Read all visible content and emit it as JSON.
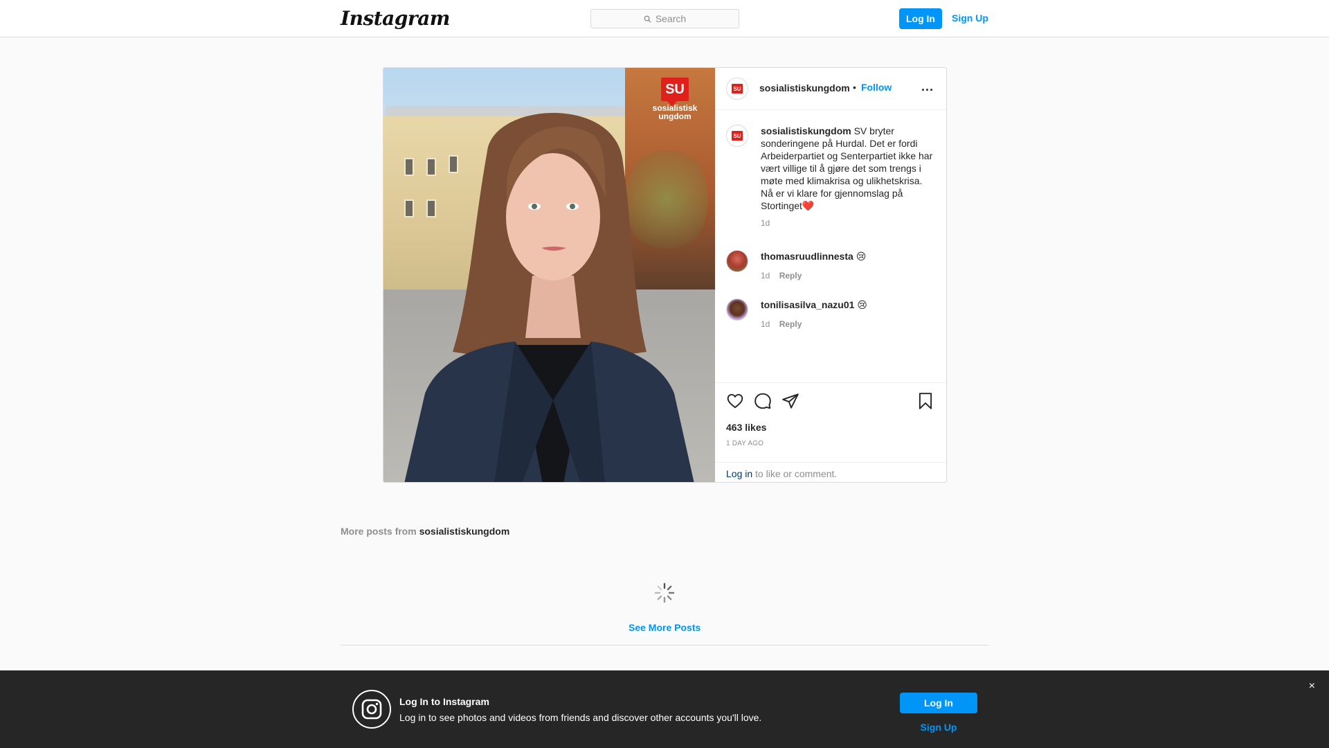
{
  "header": {
    "logo_text": "Instagram",
    "search_placeholder": "Search",
    "login_label": "Log In",
    "signup_label": "Sign Up"
  },
  "post": {
    "image_badge": {
      "mark": "SU",
      "name_line1": "sosialistisk",
      "name_line2": "ungdom"
    },
    "username": "sosialistiskungdom",
    "bullet": "•",
    "follow_label": "Follow",
    "more_label": "...",
    "avatar_mark": "SU",
    "caption": {
      "username": "sosialistiskungdom",
      "text": "SV bryter sonderingene på Hurdal. Det er fordi Arbeiderpartiet og Senterpartiet ikke har vært villige til å gjøre det som trengs i møte med klimakrisa og ulikhetskrisa. Nå er vi klare for gjennomslag på Stortinget❤️",
      "time": "1d"
    },
    "comments": [
      {
        "username": "thomasruudlinnesta",
        "text": "😢",
        "time": "1d",
        "reply_label": "Reply"
      },
      {
        "username": "tonilisasilva_nazu01",
        "text": "😢",
        "time": "1d",
        "reply_label": "Reply"
      }
    ],
    "likes": "463 likes",
    "time_ago": "1 DAY AGO",
    "login_prompt": {
      "link": "Log in",
      "text": " to like or comment."
    },
    "icons": [
      "heart-icon",
      "comment-icon",
      "share-icon",
      "bookmark-icon"
    ]
  },
  "more_posts": {
    "prefix": "More posts from ",
    "username": "sosialistiskungdom",
    "see_more_label": "See More Posts"
  },
  "banner": {
    "title": "Log In to Instagram",
    "subtitle": "Log in to see photos and videos from friends and discover other accounts you'll love.",
    "login_label": "Log In",
    "signup_label": "Sign Up",
    "close_label": "×"
  },
  "colors": {
    "accent": "#0095f6",
    "su_red": "#e0211b",
    "banner_bg": "#262626"
  }
}
